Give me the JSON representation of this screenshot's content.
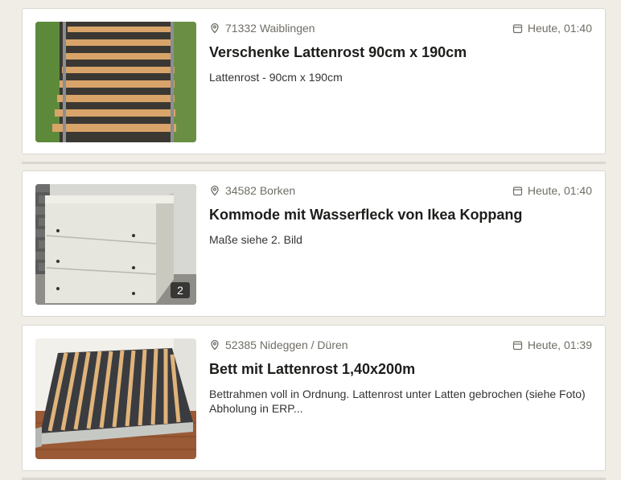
{
  "listings": [
    {
      "location": "71332 Waiblingen",
      "date": "Heute, 01:40",
      "title": "Verschenke Lattenrost 90cm x 190cm",
      "description": "Lattenrost - 90cm x 190cm",
      "image_count": "",
      "icons": {
        "location": "map-pin-icon",
        "date": "calendar-icon"
      }
    },
    {
      "location": "34582 Borken",
      "date": "Heute, 01:40",
      "title": "Kommode mit Wasserfleck von Ikea Koppang",
      "description": "Maße siehe 2. Bild",
      "image_count": "2",
      "icons": {
        "location": "map-pin-icon",
        "date": "calendar-icon"
      }
    },
    {
      "location": "52385 Nideggen / Düren",
      "date": "Heute, 01:39",
      "title": "Bett mit Lattenrost 1,40x200m",
      "description": "Bettrahmen voll in Ordnung. Lattenrost unter Latten gebrochen (siehe Foto) Abholung in ERP...",
      "image_count": "",
      "icons": {
        "location": "map-pin-icon",
        "date": "calendar-icon"
      }
    }
  ],
  "colors": {
    "page_bg": "#efede6",
    "card_bg": "#ffffff",
    "meta_text": "#6f6d65"
  }
}
